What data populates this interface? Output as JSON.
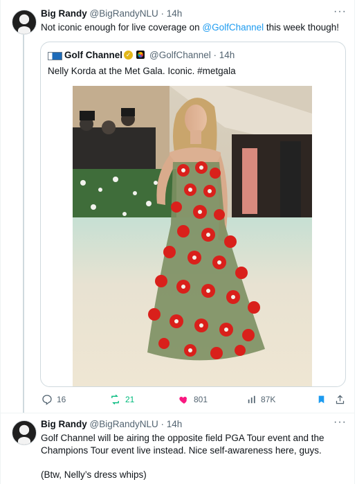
{
  "tweet1": {
    "name": "Big Randy",
    "handle": "@BigRandyNLU",
    "time": "· 14h",
    "text_before": "Not iconic enough for live coverage on ",
    "mention": "@GolfChannel",
    "text_after": " this week though!"
  },
  "quote": {
    "name": "Golf Channel",
    "handle": "@GolfChannel",
    "time": "· 14h",
    "text": "Nelly Korda at the Met Gala. Iconic. #metgala"
  },
  "actions": {
    "replies": "16",
    "reposts": "21",
    "likes": "801",
    "views": "87K"
  },
  "tweet2": {
    "name": "Big Randy",
    "handle": "@BigRandyNLU",
    "time": "· 14h",
    "line1": "Golf Channel will be airing the opposite field PGA Tour event and the",
    "line2": "Champions Tour event live instead. Nice self-awareness here, guys.",
    "line3": "(Btw, Nelly’s dress whips)"
  },
  "more_glyph": "···",
  "colors": {
    "accent": "#1d9bf0",
    "like": "#f91880",
    "repost": "#00ba7c",
    "muted": "#536471"
  },
  "icons": [
    "reply-icon",
    "repost-icon",
    "heart-icon",
    "views-icon",
    "bookmark-icon",
    "share-icon",
    "more-icon",
    "verified-icon"
  ]
}
